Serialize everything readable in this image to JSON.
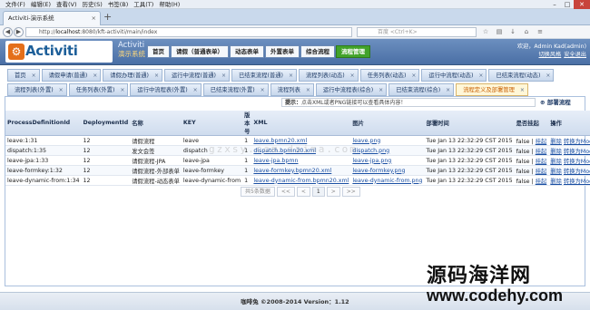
{
  "menubar": [
    "文件(F)",
    "编辑(E)",
    "查看(V)",
    "历史(S)",
    "书签(B)",
    "工具(T)",
    "帮助(H)"
  ],
  "browser": {
    "tab_title": "Activiti-演示系统",
    "url_prefix": "http://",
    "url_host": "localhost",
    "url_rest": ":8080/kft-activiti/main/index",
    "search_placeholder": "百度 <Ctrl+K>"
  },
  "app": {
    "logo_text": "Activiti",
    "brand_title": "Activiti",
    "brand_sub": "演示系统",
    "nav": [
      "首页",
      "请假（普通表单）",
      "动态表单",
      "外置表单",
      "综合流程",
      "流程管理"
    ],
    "nav_active": "流程管理",
    "welcome": "欢迎，Admin Kad(admin)",
    "switch_style": "切换风格",
    "logout": "安全退出"
  },
  "tabs_row1": [
    "首页",
    "请假申请(普通)",
    "请假办理(普通)",
    "运行中流程(普通)",
    "已结束流程(普通)",
    "流程列表(动态)",
    "任务列表(动态)",
    "运行中流程(动态)",
    "已结束流程(动态)"
  ],
  "tabs_row2": [
    "流程列表(外置)",
    "任务列表(外置)",
    "运行中流程表(外置)",
    "已结束流程(外置)",
    "流程列表",
    "运行中流程表(综合)",
    "已结束流程(综合)",
    "流程定义及部署管理"
  ],
  "active_tab": "流程定义及部署管理",
  "toolbar": {
    "hint_label": "提示：",
    "hint_text": "点击XML或者PNG链接可以查看具体内容！",
    "deploy_label": "部署流程"
  },
  "table": {
    "headers": [
      "ProcessDefinitionId",
      "DeploymentId",
      "名称",
      "KEY",
      "版本号",
      "XML",
      "图片",
      "部署时间",
      "是否挂起",
      "操作"
    ],
    "rows": [
      {
        "id": "leave:1:31",
        "dep": "12",
        "name": "请假流程",
        "key": "leave",
        "ver": "1",
        "xml": "leave.bpmn20.xml",
        "png": "leave.png",
        "time": "Tue Jan 13 22:32:29 CST 2015",
        "suspend": "false",
        "suspend_action": "挂起",
        "ops": [
          "删除",
          "转换为Model"
        ]
      },
      {
        "id": "dispatch:1:35",
        "dep": "12",
        "name": "发文会签",
        "key": "dispatch",
        "ver": "1",
        "xml": "dispatch.bpmn20.xml",
        "png": "dispatch.png",
        "time": "Tue Jan 13 22:32:29 CST 2015",
        "suspend": "false",
        "suspend_action": "挂起",
        "ops": [
          "删除",
          "转换为Model"
        ]
      },
      {
        "id": "leave-jpa:1:33",
        "dep": "12",
        "name": "请假流程-JPA",
        "key": "leave-jpa",
        "ver": "1",
        "xml": "leave-jpa.bpmn",
        "png": "leave-jpa.png",
        "time": "Tue Jan 13 22:32:29 CST 2015",
        "suspend": "false",
        "suspend_action": "挂起",
        "ops": [
          "删除",
          "转换为Model"
        ]
      },
      {
        "id": "leave-formkey:1:32",
        "dep": "12",
        "name": "请假流程-外部表单",
        "key": "leave-formkey",
        "ver": "1",
        "xml": "leave-formkey.bpmn20.xml",
        "png": "leave-formkey.png",
        "time": "Tue Jan 13 22:32:29 CST 2015",
        "suspend": "false",
        "suspend_action": "挂起",
        "ops": [
          "删除",
          "转换为Model"
        ]
      },
      {
        "id": "leave-dynamic-from:1:34",
        "dep": "12",
        "name": "请假流程-动态表单",
        "key": "leave-dynamic-from",
        "ver": "1",
        "xml": "leave-dynamic-from.bpmn20.xml",
        "png": "leave-dynamic-from.png",
        "time": "Tue Jan 13 22:32:29 CST 2015",
        "suspend": "false",
        "suspend_action": "挂起",
        "ops": [
          "删除",
          "转换为Model"
        ]
      }
    ]
  },
  "pager": {
    "summary": "共5条数据",
    "first": "<<",
    "prev": "<",
    "page": "1",
    "next": ">",
    "last": ">>"
  },
  "watermark": "gzxsy.com  daima.com",
  "footer": "咖啡兔 ©2008-2014 Version：1.12",
  "overlay": {
    "cn": "源码海洋网",
    "url": "www.codehy.com"
  }
}
